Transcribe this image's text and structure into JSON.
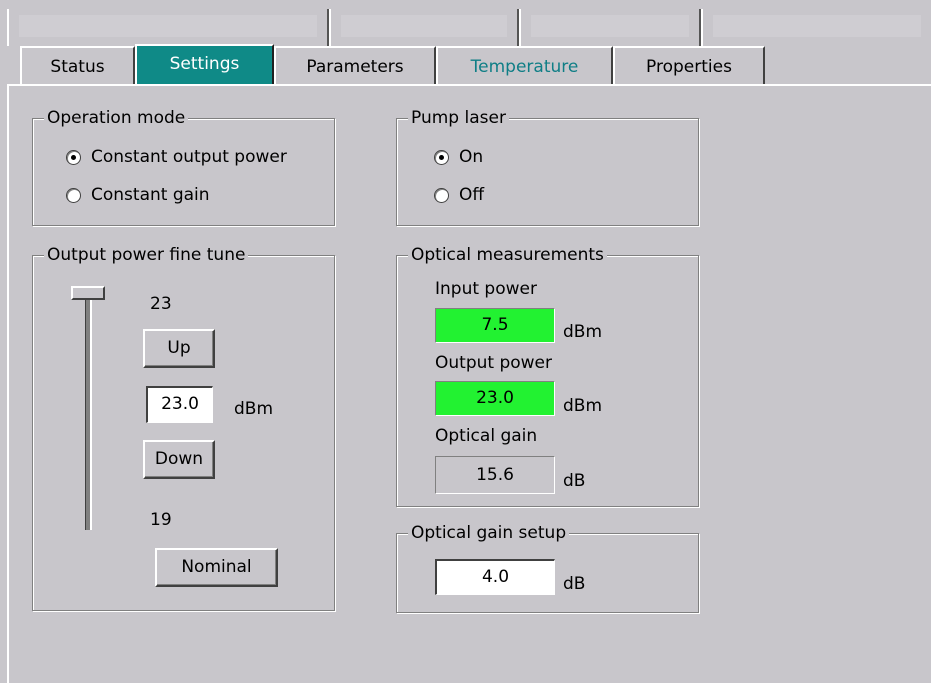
{
  "tabs": [
    {
      "label": "Status"
    },
    {
      "label": "Settings"
    },
    {
      "label": "Parameters"
    },
    {
      "label": "Temperature"
    },
    {
      "label": "Properties"
    }
  ],
  "operation_mode": {
    "title": "Operation mode",
    "options": [
      "Constant output power",
      "Constant gain"
    ],
    "selected": "Constant output power"
  },
  "pump_laser": {
    "title": "Pump laser",
    "options": [
      "On",
      "Off"
    ],
    "selected": "On"
  },
  "fine_tune": {
    "title": "Output power fine tune",
    "slider_max": "23",
    "slider_min": "19",
    "slider_value": 23,
    "up_label": "Up",
    "value": "23.0",
    "unit": "dBm",
    "down_label": "Down",
    "nominal_label": "Nominal"
  },
  "optical_measurements": {
    "title": "Optical measurements",
    "input_label": "Input power",
    "input_value": "7.5",
    "input_unit": "dBm",
    "output_label": "Output power",
    "output_value": "23.0",
    "output_unit": "dBm",
    "gain_label": "Optical gain",
    "gain_value": "15.6",
    "gain_unit": "dB",
    "ok_color": "#22f231"
  },
  "gain_setup": {
    "title": "Optical gain setup",
    "value": "4.0",
    "unit": "dB"
  }
}
